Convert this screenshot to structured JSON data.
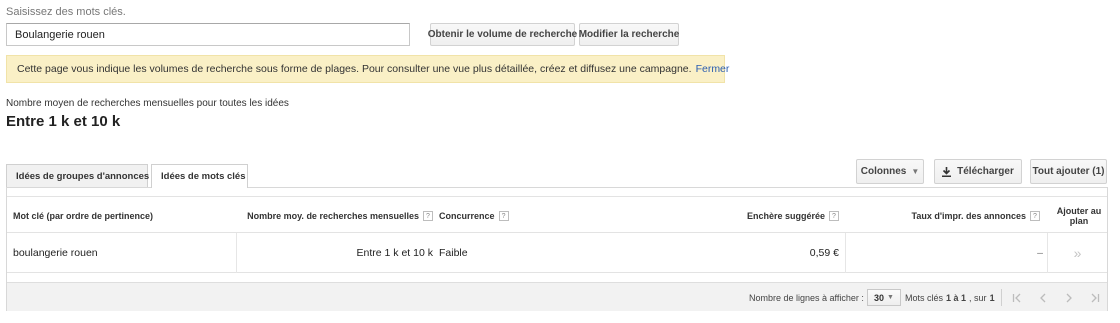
{
  "search": {
    "prompt": "Saisissez des mots clés.",
    "value": "Boulangerie rouen",
    "btn_volume": "Obtenir le volume de recherche",
    "btn_modify": "Modifier la recherche"
  },
  "notice": {
    "text": "Cette page vous indique les volumes de recherche sous forme de plages. Pour consulter une vue plus détaillée, créez et diffusez une campagne.",
    "link": "Fermer"
  },
  "summary": {
    "label": "Nombre moyen de recherches mensuelles pour toutes les idées",
    "value": "Entre 1 k et 10 k"
  },
  "tabs": [
    {
      "label": "Idées de groupes d'annonces",
      "active": false
    },
    {
      "label": "Idées de mots clés",
      "active": true
    }
  ],
  "toolbar": {
    "columns": "Colonnes",
    "download": "Télécharger",
    "add_all": "Tout ajouter (1)"
  },
  "table": {
    "headers": {
      "keyword": "Mot clé (par ordre de pertinence)",
      "avg_searches": "Nombre moy. de recherches mensuelles",
      "competition": "Concurrence",
      "suggested_bid": "Enchère suggérée",
      "impr_share": "Taux d'impr. des annonces",
      "add_to_plan_1": "Ajouter au",
      "add_to_plan_2": "plan"
    },
    "help_icon": "?",
    "rows": [
      {
        "keyword": "boulangerie rouen",
        "avg_searches": "Entre 1 k et 10 k",
        "competition": "Faible",
        "suggested_bid": "0,59 €",
        "impr_share": "–",
        "add_icon": "»"
      }
    ]
  },
  "pagination": {
    "rows_label": "Nombre de lignes à afficher :",
    "rows_value": "30",
    "range_prefix": "Mots clés",
    "range_value": "1 à 1",
    "range_sep": ", sur",
    "total": "1"
  },
  "icons": {
    "caret": "caret-down-icon",
    "download": "download-icon",
    "first": "first-page-icon",
    "prev": "previous-page-icon",
    "next": "next-page-icon",
    "last": "last-page-icon"
  },
  "colors": {
    "notice_bg": "#faf0c6",
    "link": "#2a5db0"
  }
}
